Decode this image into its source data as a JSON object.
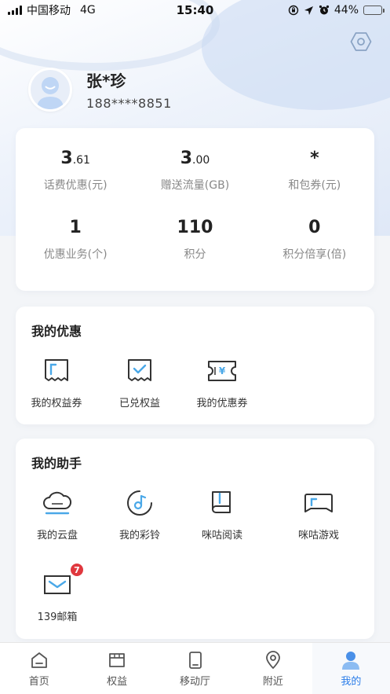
{
  "status_bar": {
    "carrier": "中国移动",
    "network": "4G",
    "time": "15:40",
    "battery": "44%",
    "battery_level": 0.44
  },
  "profile": {
    "name": "张*珍",
    "phone": "188****8851"
  },
  "stats": [
    {
      "int": "3",
      "dec": ".61",
      "label": "话费优惠(元)"
    },
    {
      "int": "3",
      "dec": ".00",
      "label": "赠送流量(GB)"
    },
    {
      "int": "*",
      "dec": "",
      "label": "和包券(元)"
    },
    {
      "int": "1",
      "dec": "",
      "label": "优惠业务(个)"
    },
    {
      "int": "110",
      "dec": "",
      "label": "积分"
    },
    {
      "int": "0",
      "dec": "",
      "label": "积分倍享(倍)"
    }
  ],
  "my_offers": {
    "title": "我的优惠",
    "items": [
      {
        "label": "我的权益券",
        "icon": "coupon-icon"
      },
      {
        "label": "已兑权益",
        "icon": "redeemed-icon"
      },
      {
        "label": "我的优惠券",
        "icon": "yen-ticket-icon"
      }
    ]
  },
  "my_helper": {
    "title": "我的助手",
    "items": [
      {
        "label": "我的云盘",
        "icon": "cloud-drive-icon"
      },
      {
        "label": "我的彩铃",
        "icon": "ringtone-icon"
      },
      {
        "label": "咪咕阅读",
        "icon": "book-icon"
      },
      {
        "label": "咪咕游戏",
        "icon": "game-icon"
      },
      {
        "label": "139邮箱",
        "icon": "mail-icon",
        "badge": "7"
      }
    ]
  },
  "tabbar": [
    {
      "label": "首页",
      "icon": "home-icon"
    },
    {
      "label": "权益",
      "icon": "shop-icon"
    },
    {
      "label": "移动厅",
      "icon": "phone-icon"
    },
    {
      "label": "附近",
      "icon": "location-icon"
    },
    {
      "label": "我的",
      "icon": "user-icon",
      "active": true
    }
  ],
  "colors": {
    "accent": "#2b7de9",
    "icon_blue": "#4aa8e8",
    "badge": "#e0383e"
  }
}
